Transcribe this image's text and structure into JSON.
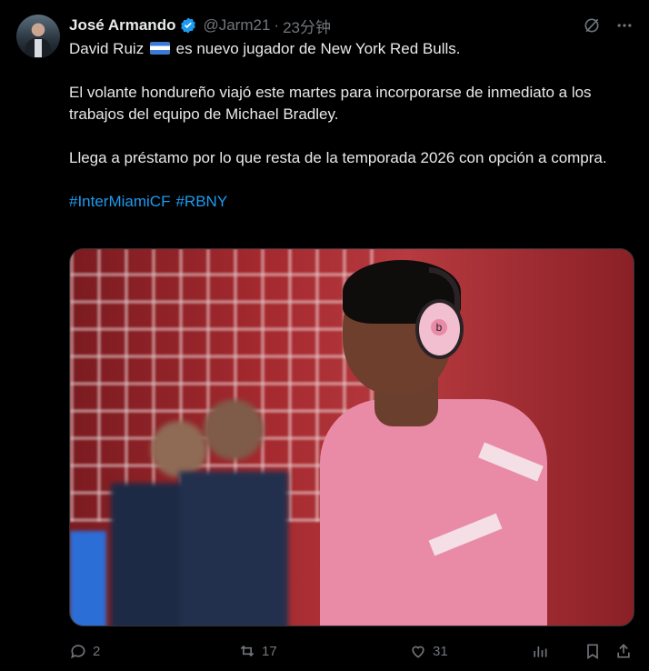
{
  "author": {
    "name": "José Armando",
    "handle": "@Jarm21",
    "separator": "·",
    "time": "23分钟",
    "verified": true
  },
  "tweet": {
    "line1_pre": "David Ruiz",
    "line1_post": "es nuevo jugador de New York Red Bulls.",
    "para2": "El volante hondureño viajó este martes para incorporarse de inmediato a los trabajos del equipo de Michael Bradley.",
    "para3": "Llega a préstamo por lo que resta de la temporada 2026 con opción a compra.",
    "hashtags": [
      "#InterMiamiCF",
      "#RBNY"
    ]
  },
  "media": {
    "headphone_letter": "b"
  },
  "actions": {
    "reply_count": "2",
    "retweet_count": "17",
    "like_count": "31"
  },
  "colors": {
    "background": "#000000",
    "text": "#e7e9ea",
    "muted": "#71767b",
    "link": "#1d9bf0",
    "verified": "#1d9bf0"
  },
  "icons": {
    "verified": "verified-badge-icon",
    "grok": "grok-icon",
    "more": "more-icon",
    "reply": "reply-icon",
    "retweet": "retweet-icon",
    "like": "heart-icon",
    "views": "views-icon",
    "bookmark": "bookmark-icon",
    "share": "share-icon"
  }
}
